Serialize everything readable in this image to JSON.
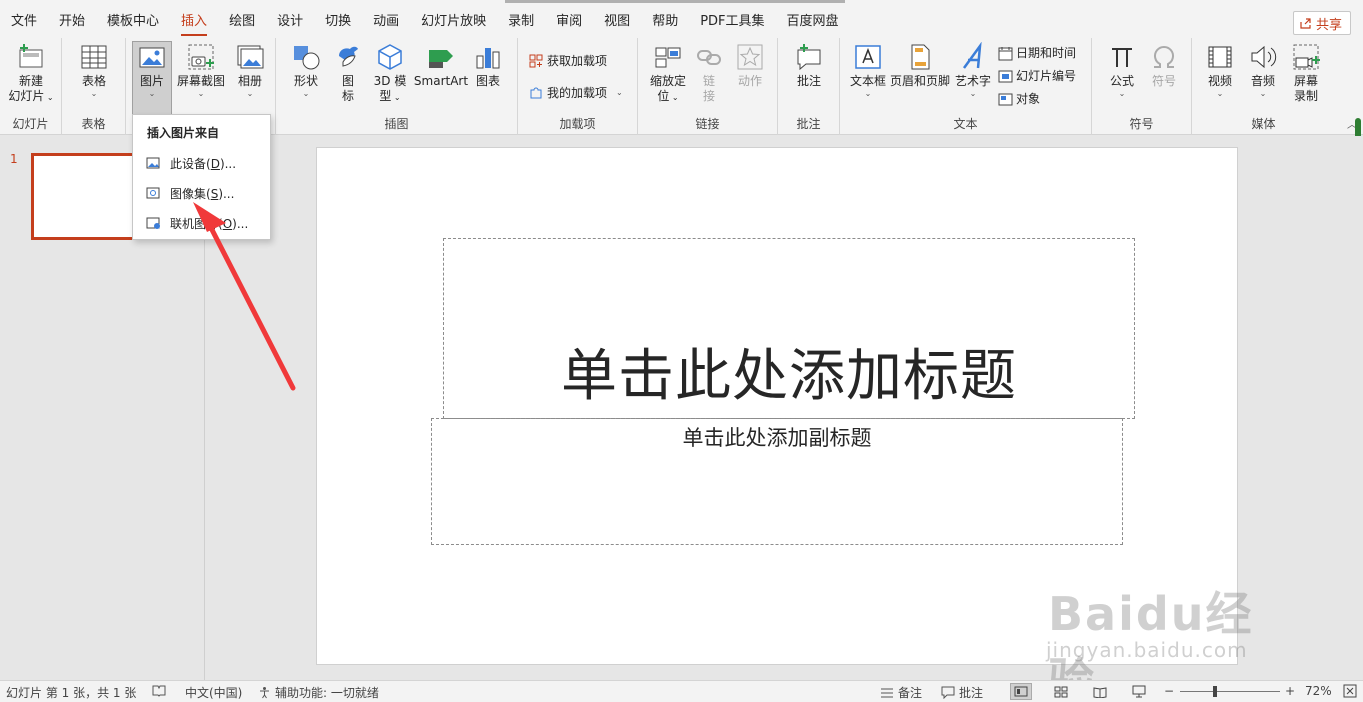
{
  "menubar": {
    "tabs": [
      {
        "label": "文件"
      },
      {
        "label": "开始"
      },
      {
        "label": "模板中心"
      },
      {
        "label": "插入"
      },
      {
        "label": "绘图"
      },
      {
        "label": "设计"
      },
      {
        "label": "切换"
      },
      {
        "label": "动画"
      },
      {
        "label": "幻灯片放映"
      },
      {
        "label": "录制"
      },
      {
        "label": "审阅"
      },
      {
        "label": "视图"
      },
      {
        "label": "帮助"
      },
      {
        "label": "PDF工具集"
      },
      {
        "label": "百度网盘"
      }
    ],
    "active_tab": "插入",
    "share_label": "共享"
  },
  "ribbon": {
    "slides": {
      "group_label": "幻灯片",
      "new_slide_line1": "新建",
      "new_slide_line2": "幻灯片"
    },
    "tables": {
      "group_label": "表格",
      "table_label": "表格"
    },
    "images": {
      "picture_label": "图片",
      "screenshot_label": "屏幕截图",
      "album_label": "相册"
    },
    "illustrations": {
      "group_label": "插图",
      "shapes_label": "形状",
      "icons_line1": "图",
      "icons_line2": "标",
      "model3d_line1": "3D 模",
      "model3d_line2": "型",
      "smartart_label": "SmartArt",
      "chart_label": "图表"
    },
    "addins": {
      "group_label": "加载项",
      "get_addins": "获取加载项",
      "my_addins": "我的加载项"
    },
    "links": {
      "group_label": "链接",
      "zoom_line1": "缩放定",
      "zoom_line2": "位",
      "link_line1": "链",
      "link_line2": "接",
      "action_label": "动作"
    },
    "comments": {
      "group_label": "批注",
      "comment_label": "批注"
    },
    "text": {
      "group_label": "文本",
      "textbox_label": "文本框",
      "header_footer_label": "页眉和页脚",
      "wordart_label": "艺术字",
      "date_time": "日期和时间",
      "slide_number": "幻灯片编号",
      "object": "对象"
    },
    "symbols": {
      "group_label": "符号",
      "equation_label": "公式",
      "symbol_label": "符号"
    },
    "media": {
      "group_label": "媒体",
      "video_label": "视频",
      "audio_label": "音频",
      "screen_rec_line1": "屏幕",
      "screen_rec_line2": "录制"
    }
  },
  "dropdown": {
    "title": "插入图片来自",
    "items": [
      {
        "text": "此设备(",
        "key": "D",
        "suffix": ")..."
      },
      {
        "text": "图像集(",
        "key": "S",
        "suffix": ")..."
      },
      {
        "text": "联机图片(",
        "key": "O",
        "suffix": ")..."
      }
    ]
  },
  "thumbnails": {
    "slide_number": "1"
  },
  "slide": {
    "title_placeholder": "单击此处添加标题",
    "subtitle_placeholder": "单击此处添加副标题"
  },
  "watermark": {
    "big": "Baidu经验",
    "small": "jingyan.baidu.com"
  },
  "status": {
    "slide_info": "幻灯片 第 1 张，共 1 张",
    "language": "中文(中国)",
    "accessibility": "辅助功能: 一切就绪",
    "notes": "备注",
    "comments": "批注",
    "zoom_minus": "−",
    "zoom_plus": "+",
    "zoom_level": "72%"
  },
  "colors": {
    "accent": "#c43e1c",
    "ribbon_bg": "#f3f3f3",
    "canvas_bg": "#e6e6e6",
    "arrow": "#f0393a"
  }
}
